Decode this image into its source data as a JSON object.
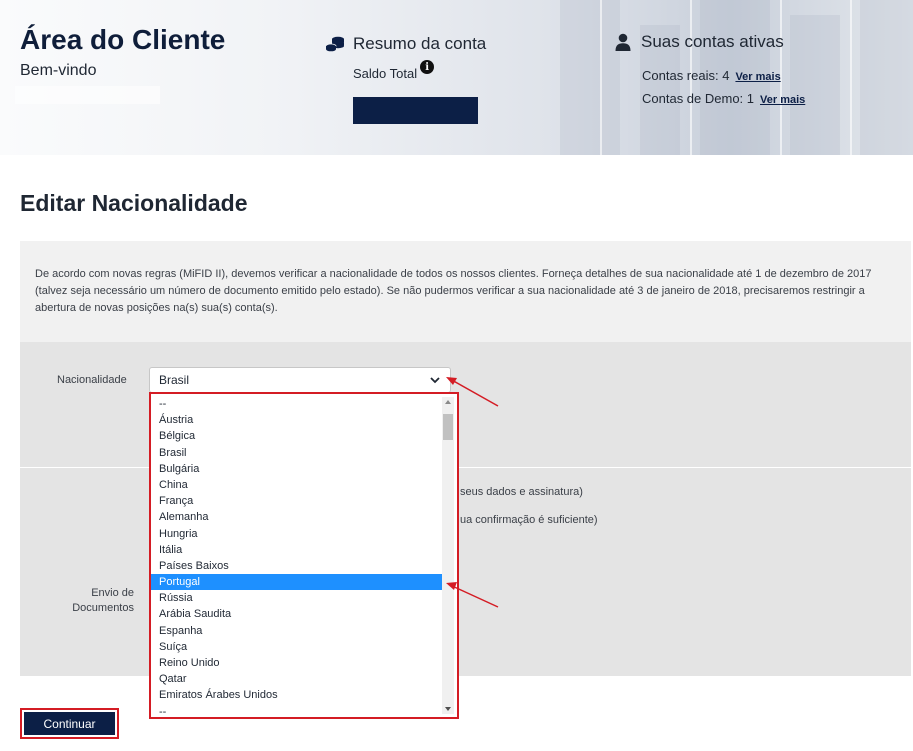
{
  "header": {
    "title": "Área do Cliente",
    "welcome": "Bem-vindo",
    "summary": {
      "title": "Resumo da conta",
      "saldo_label": "Saldo Total",
      "icon": "coins-icon",
      "info_icon": "info-icon"
    },
    "accounts": {
      "title": "Suas contas ativas",
      "icon": "user-icon",
      "real_label": "Contas reais: 4",
      "demo_label": "Contas de Demo: 1",
      "link_label": "Ver mais"
    }
  },
  "page": {
    "title": "Editar Nacionalidade",
    "notice": "De acordo com novas regras (MiFID II), devemos verificar a nacionalidade de todos os nossos clientes. Forneça detalhes de sua nacionalidade até 1 de dezembro de 2017 (talvez seja necessário um número de documento emitido pelo estado). Se não pudermos verificar a sua nacionalidade até 3 de janeiro de 2018, precisaremos restringir a abertura de novas posições na(s) sua(s) conta(s)."
  },
  "form": {
    "nationality_label": "Nacionalidade",
    "nationality_value": "Brasil",
    "obscured_text_1": "seus dados e assinatura)",
    "obscured_text_2": "ua confirmação é suficiente)",
    "documents_label": "Envio de Documentos",
    "options": [
      "--",
      "Áustria",
      "Bélgica",
      "Brasil",
      "Bulgária",
      "China",
      "França",
      "Alemanha",
      "Hungria",
      "Itália",
      "Países Baixos",
      "Portugal",
      "Rússia",
      "Arábia Saudita",
      "Espanha",
      "Suíça",
      "Reino Unido",
      "Qatar",
      "Emiratos Árabes Unidos",
      "--"
    ],
    "highlighted_option": "Portugal",
    "continue_label": "Continuar"
  },
  "colors": {
    "navy": "#0c1f46",
    "highlight": "#1e90ff",
    "annotation_red": "#d41c24"
  }
}
